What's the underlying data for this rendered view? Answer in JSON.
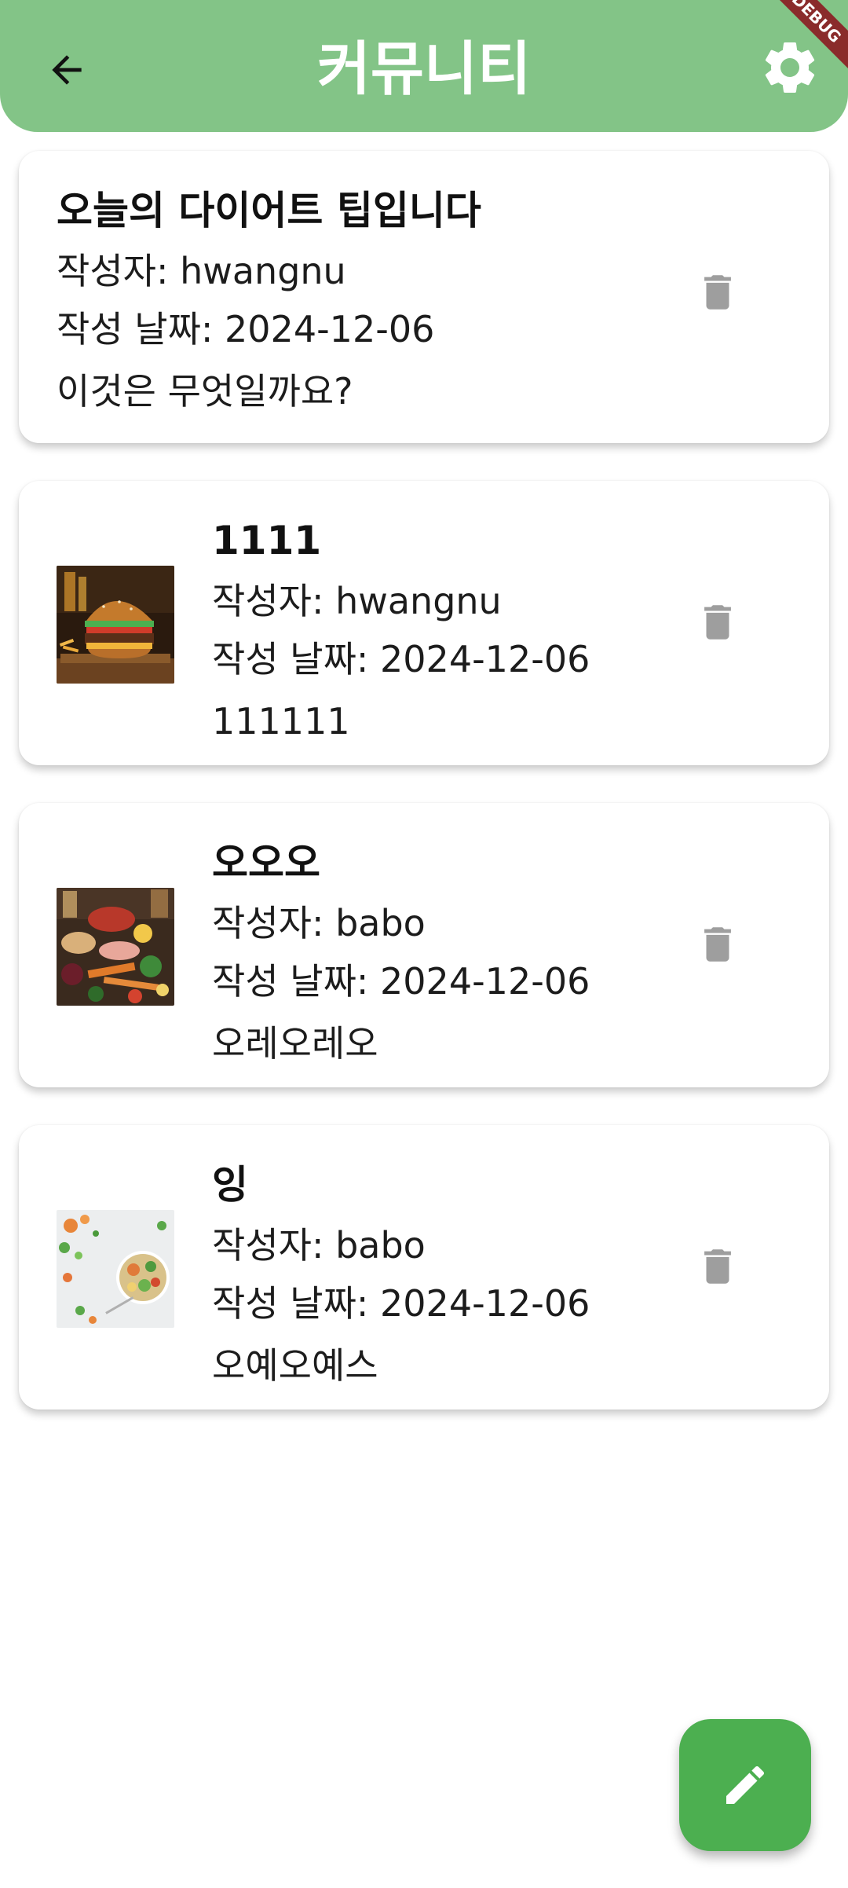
{
  "app": {
    "title": "커뮤니티",
    "debug_banner": "DEBUG",
    "colors": {
      "appbar": "#83c487",
      "fab": "#4caf50",
      "delete_icon": "#9e9e9e",
      "ribbon": "#8a2b2b"
    },
    "icons": {
      "back": "arrow-back-icon",
      "settings": "gear-icon",
      "delete": "trash-icon",
      "write": "pencil-icon"
    }
  },
  "posts": [
    {
      "title": "오늘의 다이어트 팁입니다",
      "author_line": "작성자: hwangnu",
      "date_line": "작성 날짜: 2024-12-06",
      "body": "이것은 무엇일까요?",
      "image": null
    },
    {
      "title": "1111",
      "author_line": "작성자: hwangnu",
      "date_line": "작성 날짜: 2024-12-06",
      "body": "111111",
      "image": "burger-photo"
    },
    {
      "title": "오오오",
      "author_line": "작성자: babo",
      "date_line": "작성 날짜: 2024-12-06",
      "body": "오레오레오",
      "image": "healthy-food-spread-photo"
    },
    {
      "title": "잉",
      "author_line": "작성자: babo",
      "date_line": "작성 날짜: 2024-12-06",
      "body": "오예오예스",
      "image": "salad-bowl-photo"
    }
  ]
}
